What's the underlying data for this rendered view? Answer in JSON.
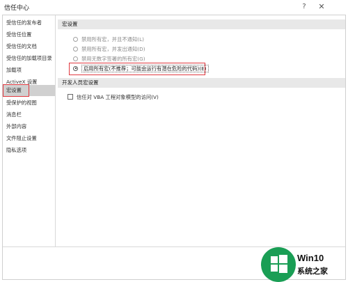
{
  "window": {
    "title": "信任中心",
    "help_label": "?",
    "close_label": "✕"
  },
  "sidebar": {
    "items": [
      {
        "label": "受信任的发布者"
      },
      {
        "label": "受信任位置"
      },
      {
        "label": "受信任的文档"
      },
      {
        "label": "受信任的加载项目录"
      },
      {
        "label": "加载项"
      },
      {
        "label": "ActiveX 设置"
      },
      {
        "label": "宏设置",
        "selected": true
      },
      {
        "label": "受保护的视图"
      },
      {
        "label": "消息栏"
      },
      {
        "label": "外部内容"
      },
      {
        "label": "文件阻止设置"
      },
      {
        "label": "隐私选项"
      }
    ]
  },
  "macro_settings": {
    "header": "宏设置",
    "options": [
      {
        "label": "禁用所有宏，并且不通知(L)",
        "checked": false
      },
      {
        "label": "禁用所有宏，并发出通知(D)",
        "checked": false
      },
      {
        "label": "禁用无数字签署的所有宏(G)",
        "checked": false
      },
      {
        "label": "启用所有宏(不推荐；可能会运行有潜在危险的代码)(E)",
        "checked": true
      }
    ]
  },
  "developer_settings": {
    "header": "开发人员宏设置",
    "vba_access_label": "信任对 VBA 工程对象模型的访问(V)",
    "vba_access_checked": false
  },
  "watermark": {
    "line1": "Win10",
    "line2": "系统之家"
  },
  "colors": {
    "highlight_red": "#e0383f",
    "selected_bg": "#d0d0d0",
    "section_bg": "#e8e8e8",
    "logo_green": "#1a9e55"
  }
}
